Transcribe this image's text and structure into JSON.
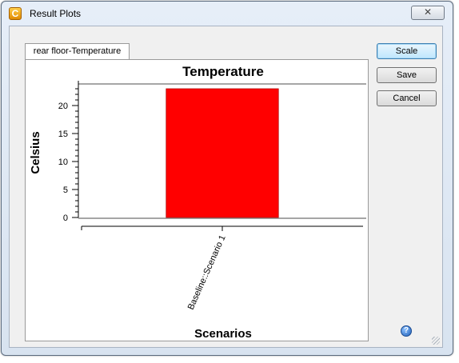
{
  "window": {
    "title": "Result Plots",
    "close_glyph": "✕",
    "app_icon_letter": "C"
  },
  "tabs": [
    {
      "label": "rear floor-Temperature",
      "active": true
    }
  ],
  "buttons": {
    "scale": "Scale",
    "save": "Save",
    "cancel": "Cancel"
  },
  "help_glyph": "?",
  "chart_data": {
    "type": "bar",
    "title": "Temperature",
    "xlabel": "Scenarios",
    "ylabel": "Celsius",
    "categories": [
      "Baseline::Scenario 1"
    ],
    "values": [
      23
    ],
    "ylim": [
      0,
      23
    ],
    "yticks": [
      0,
      5,
      10,
      15,
      20
    ],
    "bar_color": "#ff0000",
    "grid": false,
    "legend": "none"
  }
}
